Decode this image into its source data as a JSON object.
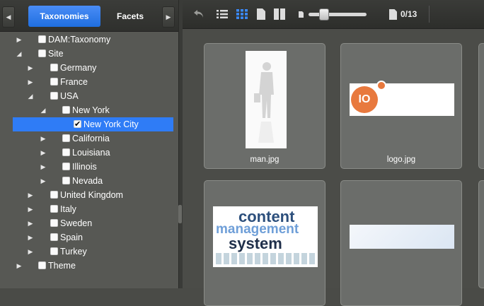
{
  "tabs": {
    "taxonomies": "Taxonomies",
    "facets": "Facets"
  },
  "tree": [
    {
      "label": "DAM:Taxonomy",
      "expanded": false,
      "checked": false
    },
    {
      "label": "Site",
      "expanded": true,
      "checked": false
    },
    {
      "label": "Germany",
      "expanded": false,
      "checked": false
    },
    {
      "label": "France",
      "expanded": false,
      "checked": false
    },
    {
      "label": "USA",
      "expanded": true,
      "checked": false
    },
    {
      "label": "New York",
      "expanded": true,
      "checked": false
    },
    {
      "label": "New York City",
      "expanded": false,
      "checked": true
    },
    {
      "label": "California",
      "expanded": false,
      "checked": false
    },
    {
      "label": "Louisiana",
      "expanded": false,
      "checked": false
    },
    {
      "label": "Illinois",
      "expanded": false,
      "checked": false
    },
    {
      "label": "Nevada",
      "expanded": false,
      "checked": false
    },
    {
      "label": "United Kingdom",
      "expanded": false,
      "checked": false
    },
    {
      "label": "Italy",
      "expanded": false,
      "checked": false
    },
    {
      "label": "Sweden",
      "expanded": false,
      "checked": false
    },
    {
      "label": "Spain",
      "expanded": false,
      "checked": false
    },
    {
      "label": "Turkey",
      "expanded": false,
      "checked": false
    },
    {
      "label": "Theme",
      "expanded": false,
      "checked": false
    }
  ],
  "toolbar": {
    "counter": "0/13",
    "zoom_level": 0.45
  },
  "assets": [
    {
      "name": "man.jpg"
    },
    {
      "name": "logo.jpg"
    },
    {
      "name": ""
    },
    {
      "name": ""
    }
  ],
  "logo_text": "IO",
  "wordcloud": {
    "big1": "content",
    "big2": "management",
    "big3": "system"
  },
  "colors": {
    "accent": "#2f7cf6",
    "logo": "#e8793e"
  }
}
